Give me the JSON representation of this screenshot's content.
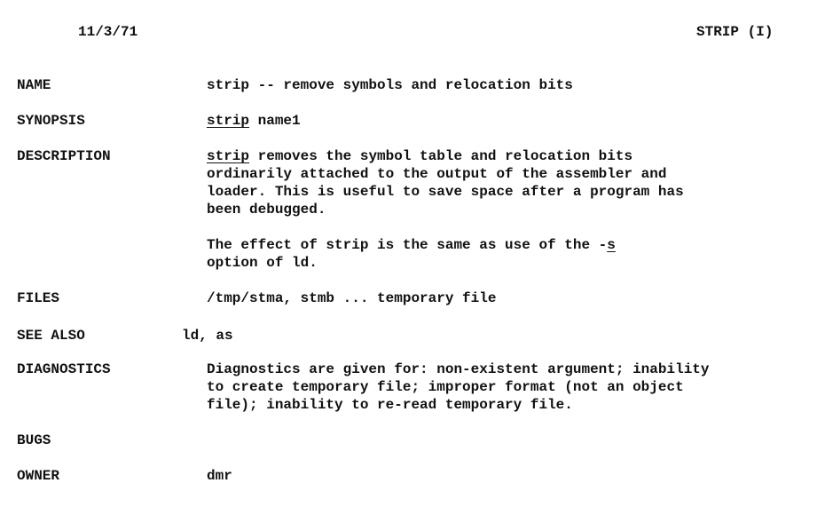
{
  "header": {
    "date": "11/3/71",
    "title": "STRIP (I)"
  },
  "name": {
    "label": "NAME",
    "text": "strip -- remove symbols and relocation bits"
  },
  "synopsis": {
    "label": "SYNOPSIS",
    "command": "strip",
    "args": " name1"
  },
  "description": {
    "label": "DESCRIPTION",
    "command": "strip",
    "line1_rest": " removes the symbol table and relocation bits",
    "line2": "ordinarily attached to the output of the assembler and",
    "line3": "loader. This is useful to save space after a program has",
    "line4": "been debugged.",
    "para2_line1_pre": "The effect of strip is the same as use of the -",
    "para2_flag": "s",
    "para2_line2": "option of ld."
  },
  "files": {
    "label": "FILES",
    "text": "/tmp/stma, stmb ... temporary file"
  },
  "see_also": {
    "label": "SEE ALSO",
    "text": "ld, as"
  },
  "diagnostics": {
    "label": "DIAGNOSTICS",
    "line1": "Diagnostics are given for: non-existent argument; inability",
    "line2": "to create temporary file; improper format (not an object",
    "line3": "file); inability to re-read temporary file."
  },
  "bugs": {
    "label": "BUGS"
  },
  "owner": {
    "label": "OWNER",
    "text": "dmr"
  }
}
